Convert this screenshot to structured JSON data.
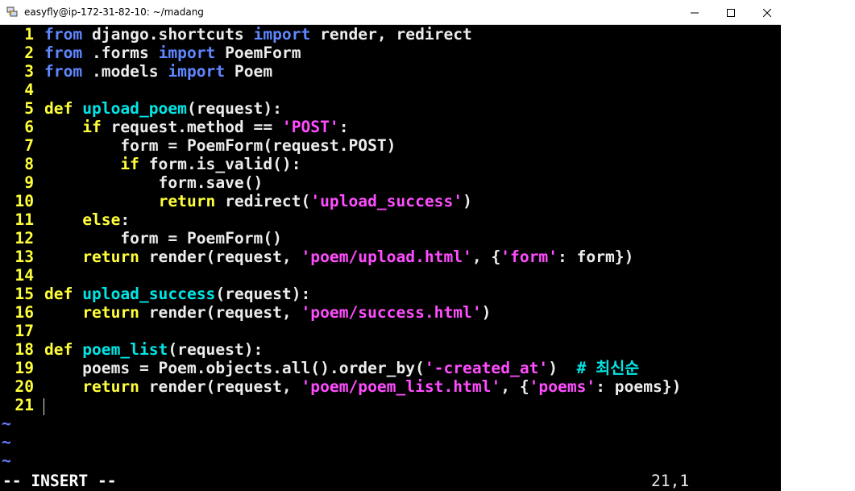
{
  "window": {
    "title": "easyfly@ip-172-31-82-10: ~/madang",
    "app_icon": "putty-icon",
    "controls": [
      "minimize-icon",
      "maximize-icon",
      "close-icon"
    ]
  },
  "editor": {
    "line_numbers": [
      "1",
      "2",
      "3",
      "4",
      "5",
      "6",
      "7",
      "8",
      "9",
      "10",
      "11",
      "12",
      "13",
      "14",
      "15",
      "16",
      "17",
      "18",
      "19",
      "20",
      "21"
    ],
    "lines": [
      [
        [
          "kw",
          "from"
        ],
        [
          "t",
          " django.shortcuts "
        ],
        [
          "kw",
          "import"
        ],
        [
          "t",
          " render, redirect"
        ]
      ],
      [
        [
          "kw",
          "from"
        ],
        [
          "t",
          " .forms "
        ],
        [
          "kw",
          "import"
        ],
        [
          "t",
          " PoemForm"
        ]
      ],
      [
        [
          "kw",
          "from"
        ],
        [
          "t",
          " .models "
        ],
        [
          "kw",
          "import"
        ],
        [
          "t",
          " Poem"
        ]
      ],
      [],
      [
        [
          "kwy",
          "def"
        ],
        [
          "t",
          " "
        ],
        [
          "fn",
          "upload_poem"
        ],
        [
          "t",
          "(request):"
        ]
      ],
      [
        [
          "t",
          "    "
        ],
        [
          "kwy",
          "if"
        ],
        [
          "t",
          " request.method == "
        ],
        [
          "str",
          "'POST'"
        ],
        [
          "t",
          ":"
        ]
      ],
      [
        [
          "t",
          "        form = PoemForm(request.POST)"
        ]
      ],
      [
        [
          "t",
          "        "
        ],
        [
          "kwy",
          "if"
        ],
        [
          "t",
          " form.is_valid():"
        ]
      ],
      [
        [
          "t",
          "            form.save()"
        ]
      ],
      [
        [
          "t",
          "            "
        ],
        [
          "kwy",
          "return"
        ],
        [
          "t",
          " redirect("
        ],
        [
          "str",
          "'upload_success'"
        ],
        [
          "t",
          ")"
        ]
      ],
      [
        [
          "t",
          "    "
        ],
        [
          "kwy",
          "else"
        ],
        [
          "t",
          ":"
        ]
      ],
      [
        [
          "t",
          "        form = PoemForm()"
        ]
      ],
      [
        [
          "t",
          "    "
        ],
        [
          "kwy",
          "return"
        ],
        [
          "t",
          " render(request, "
        ],
        [
          "str",
          "'poem/upload.html'"
        ],
        [
          "t",
          ", {"
        ],
        [
          "str",
          "'form'"
        ],
        [
          "t",
          ": form})"
        ]
      ],
      [],
      [
        [
          "kwy",
          "def"
        ],
        [
          "t",
          " "
        ],
        [
          "fn",
          "upload_success"
        ],
        [
          "t",
          "(request):"
        ]
      ],
      [
        [
          "t",
          "    "
        ],
        [
          "kwy",
          "return"
        ],
        [
          "t",
          " render(request, "
        ],
        [
          "str",
          "'poem/success.html'"
        ],
        [
          "t",
          ")"
        ]
      ],
      [],
      [
        [
          "kwy",
          "def"
        ],
        [
          "t",
          " "
        ],
        [
          "fn",
          "poem_list"
        ],
        [
          "t",
          "(request):"
        ]
      ],
      [
        [
          "t",
          "    poems = Poem.objects.all().order_by("
        ],
        [
          "str",
          "'-created_at'"
        ],
        [
          "t",
          ")  "
        ],
        [
          "cmt",
          "# 최신순"
        ]
      ],
      [
        [
          "t",
          "    "
        ],
        [
          "kwy",
          "return"
        ],
        [
          "t",
          " render(request, "
        ],
        [
          "str",
          "'poem/poem_list.html'"
        ],
        [
          "t",
          ", {"
        ],
        [
          "str",
          "'poems'"
        ],
        [
          "t",
          ": poems})"
        ]
      ],
      []
    ],
    "empty_marker": "~",
    "empty_marker_count": 3
  },
  "statusline": {
    "mode": "-- INSERT --",
    "position": "21,1"
  },
  "colors": {
    "background": "#000000",
    "line_number": "#ffff3c",
    "keyword_blue": "#5f87ff",
    "keyword_yellow": "#ffff3c",
    "function_name": "#00e6e6",
    "string": "#ff4dff",
    "text": "#ececec"
  }
}
